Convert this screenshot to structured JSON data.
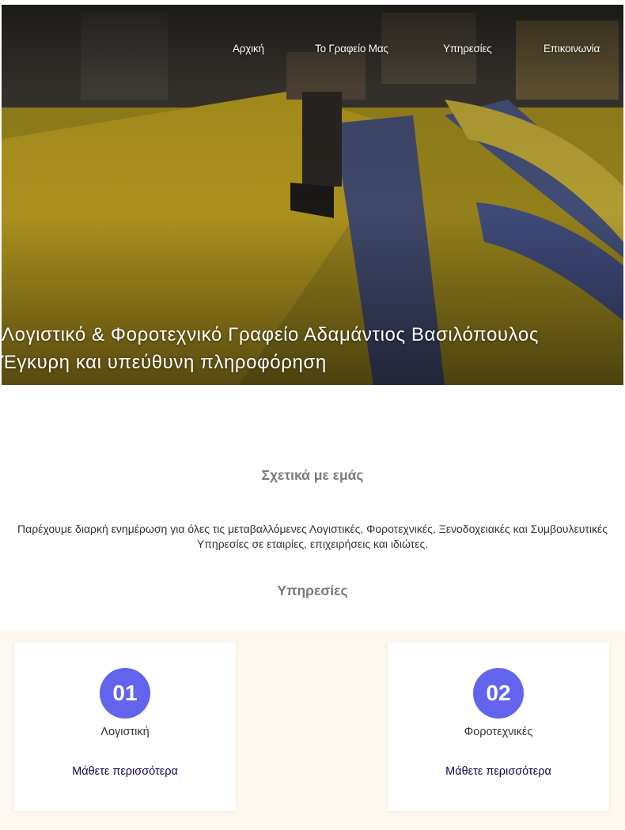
{
  "nav": {
    "items": [
      {
        "label": "Αρχική"
      },
      {
        "label": "Το Γραφείο Μας"
      },
      {
        "label": "Υπηρεσίες"
      },
      {
        "label": "Επικοινωνία"
      }
    ]
  },
  "hero": {
    "title_line1": "Λογιστικό & Φοροτεχνικό Γραφείο Αδαμάντιος Βασιλόπουλος",
    "title_line2": "Έγκυρη και υπεύθυνη πληροφόρηση"
  },
  "about": {
    "heading": "Σχετικά με εμάς",
    "text": "Παρέχουμε διαρκή ενημέρωση για όλες τις μεταβαλλόμενες Λογιστικές, Φοροτεχνικές, Ξενοδοχειακές και Συμβουλευτικές Υπηρεσίες σε εταιρίες, επιχειρήσεις και ιδιώτες."
  },
  "services": {
    "heading": "Υπηρεσίες",
    "cards": [
      {
        "number": "01",
        "title": "Λογιστική",
        "link": "Μάθετε περισσότερα"
      },
      {
        "number": "02",
        "title": "Φοροτεχνικές",
        "link": "Μάθετε περισσότερα"
      }
    ]
  },
  "colors": {
    "accent": "#6264ee",
    "link": "#0b0a52",
    "heading": "#7a7a7a",
    "band": "#fdf9f1"
  }
}
